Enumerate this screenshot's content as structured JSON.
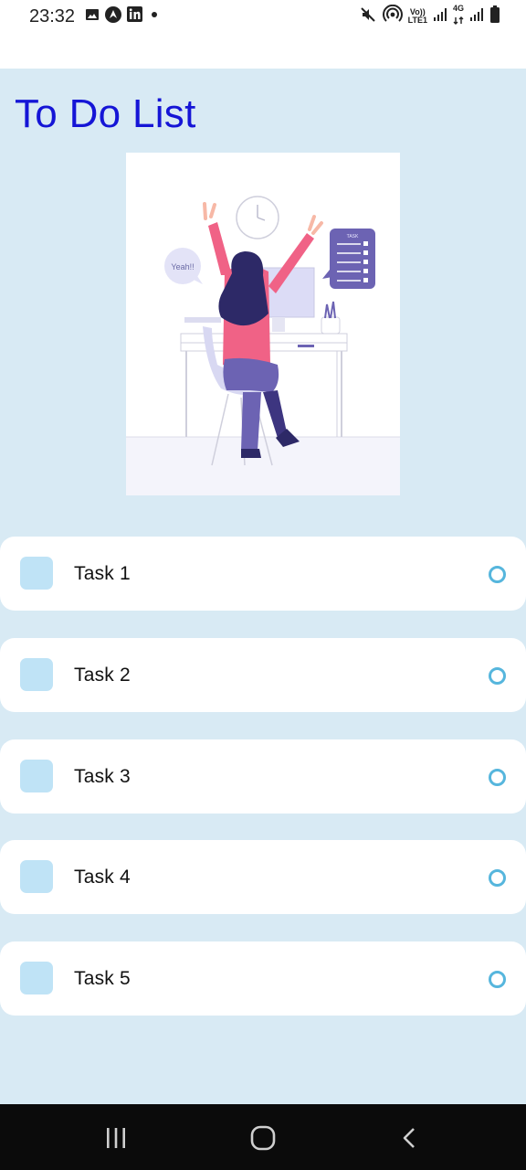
{
  "status_bar": {
    "time": "23:32",
    "left_icons": [
      "image-icon",
      "app-icon",
      "linkedin-icon",
      "dot-icon"
    ],
    "right_icons": [
      "mute-icon",
      "hotspot-icon",
      "volte-icon",
      "signal-icon",
      "4g-icon",
      "signal-icon",
      "battery-icon"
    ],
    "volte_label_top": "Vo))",
    "volte_label_bottom": "LTE1",
    "network_label": "4G"
  },
  "app": {
    "title": "To Do List",
    "illustration_bubble_text": "Yeah!!",
    "illustration_task_label": "TASK"
  },
  "tasks": [
    {
      "label": "Task 1",
      "checked": false
    },
    {
      "label": "Task 2",
      "checked": false
    },
    {
      "label": "Task 3",
      "checked": false
    },
    {
      "label": "Task 4",
      "checked": false
    },
    {
      "label": "Task 5",
      "checked": false
    }
  ],
  "nav_bar": {
    "buttons": [
      "recents-icon",
      "home-icon",
      "back-icon"
    ]
  },
  "colors": {
    "title": "#1515d6",
    "background": "#d8eaf4",
    "checkbox": "#bfe3f6",
    "status_ring": "#56b6dd"
  }
}
